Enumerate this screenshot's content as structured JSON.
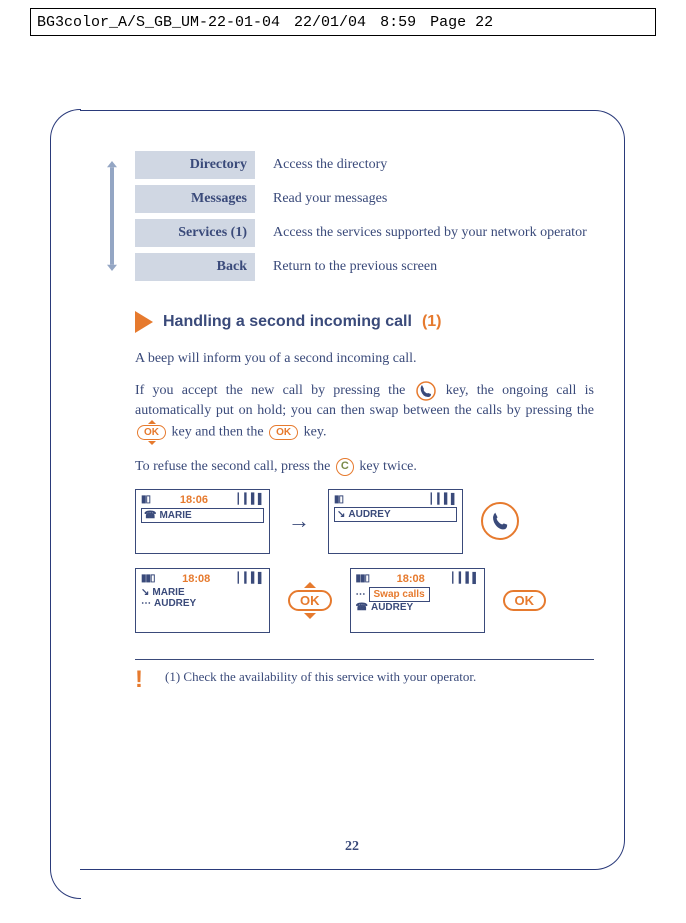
{
  "crop": {
    "file": "BG3color_A/S_GB_UM-22-01-04",
    "date": "22/01/04",
    "time": "8:59",
    "page": "Page 22"
  },
  "menu": [
    {
      "label": "Directory",
      "desc": "Access the directory"
    },
    {
      "label": "Messages",
      "desc": "Read your messages"
    },
    {
      "label": "Services (1)",
      "desc": "Access the services supported by your network operator"
    },
    {
      "label": "Back",
      "desc": "Return to the previous screen"
    }
  ],
  "section": {
    "title": "Handling a second incoming call",
    "note": "(1)"
  },
  "para1": "A beep will inform you of a second incoming call.",
  "para2a": "If you accept the new call by pressing the ",
  "para2b": " key, the ongoing call is automatically put on hold; you can then swap between the calls by pressing the ",
  "para2c": " key and then the ",
  "para2d": " key.",
  "para3a": "To refuse the second call, press the ",
  "para3b": " key twice.",
  "screens": {
    "s1": {
      "time": "18:06",
      "name": "MARIE"
    },
    "s2": {
      "name": "AUDREY"
    },
    "s3": {
      "time": "18:08",
      "line1": "MARIE",
      "line2": "AUDREY"
    },
    "s4": {
      "time": "18:08",
      "swap": "Swap calls",
      "line2": "AUDREY"
    }
  },
  "ok_label": "OK",
  "c_label": "C",
  "footnote": "(1) Check the availability of this service with your operator.",
  "page_number": "22"
}
